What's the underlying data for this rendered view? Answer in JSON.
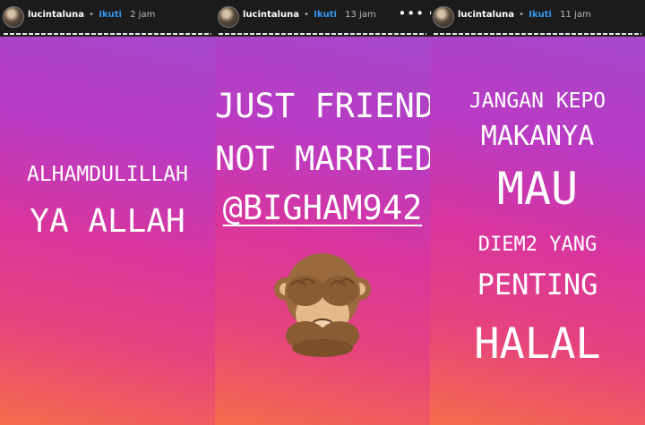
{
  "stories": [
    {
      "username": "lucintaluna",
      "separator": "•",
      "follow": "Ikuti",
      "time": "2 jam",
      "more": "•••",
      "lines": [
        "ALHAMDULILLAH",
        "YA ALLAH"
      ]
    },
    {
      "username": "lucintaluna",
      "separator": "•",
      "follow": "Ikuti",
      "time": "13 jam",
      "more": "•••",
      "lines": [
        "JUST FRIEND",
        "NOT MARRIED"
      ],
      "mention": "@BIGHAM942",
      "emoji": "see-no-evil-monkey-icon"
    },
    {
      "username": "lucintaluna",
      "separator": "•",
      "follow": "Ikuti",
      "time": "11 jam",
      "more": "•••",
      "lines": [
        "JANGAN KEPO",
        "MAKANYA",
        "MAU",
        "DIEM2 YANG",
        "PENTING",
        "HALAL"
      ]
    }
  ],
  "colors": {
    "header_bg": "#1b1b1b",
    "follow_link": "#3897f0",
    "gradient": [
      "#f46d4a",
      "#e6447d",
      "#d8359f",
      "#b93bc3",
      "#a547c9"
    ]
  }
}
